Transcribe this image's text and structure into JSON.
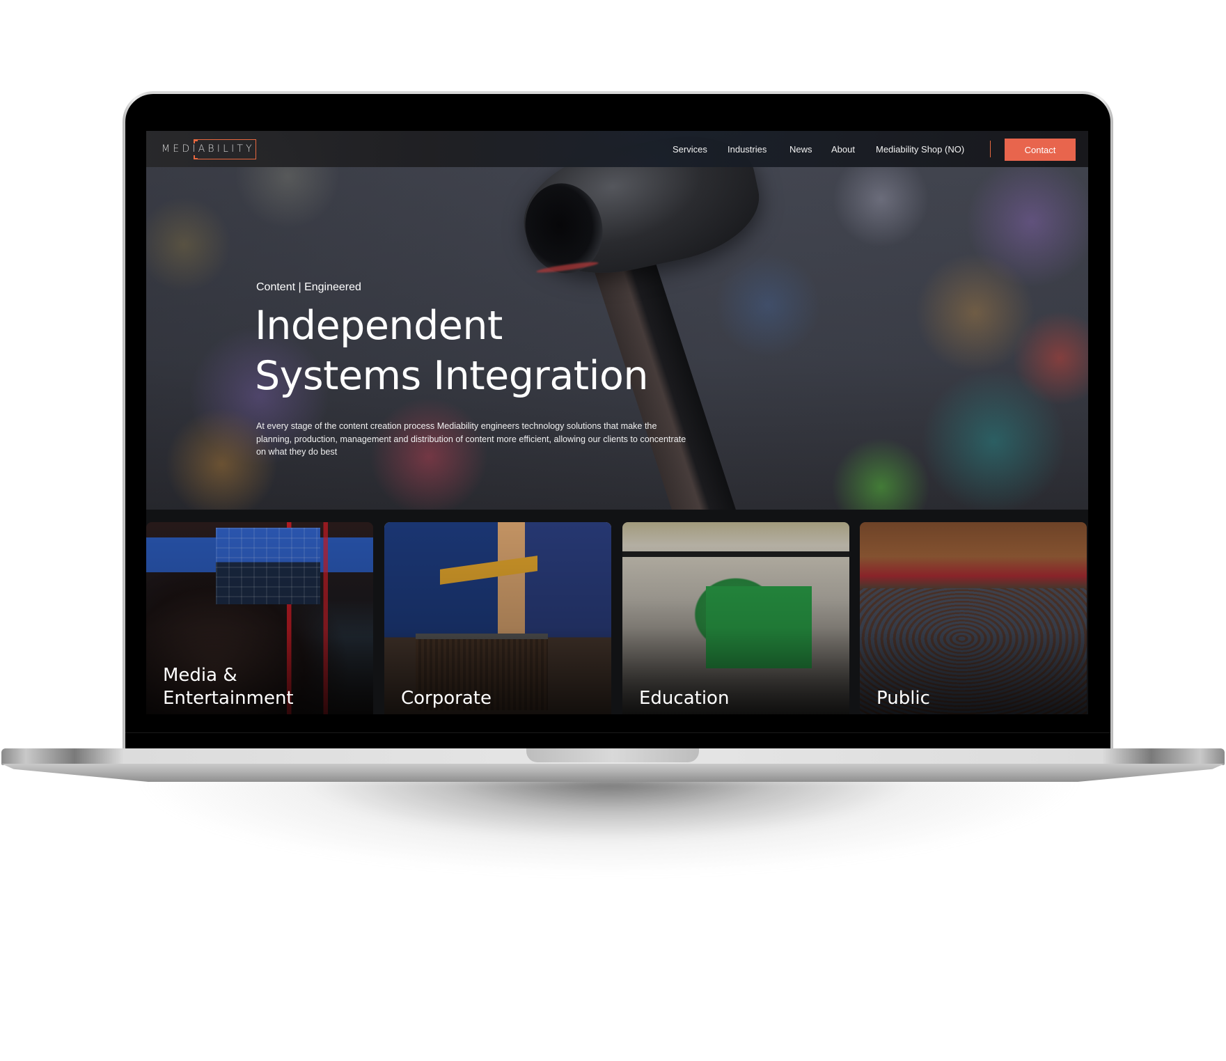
{
  "site": {
    "logo": "MEDIABILITY",
    "accent_color": "#e8654d"
  },
  "nav": {
    "items": [
      {
        "label": "Services"
      },
      {
        "label": "Industries"
      },
      {
        "label": "News"
      },
      {
        "label": "About"
      },
      {
        "label": "Mediability Shop (NO)"
      }
    ],
    "contact_label": "Contact"
  },
  "hero": {
    "eyebrow": "Content | Engineered",
    "headline_line1": "Independent",
    "headline_line2": "Systems Integration",
    "description": "At every stage of the content creation process Mediability engineers technology solutions that make the planning, production, management and distribution of content more efficient, allowing our clients to concentrate on what they do best"
  },
  "industries": [
    {
      "label": "Media & Entertainment"
    },
    {
      "label": "Corporate"
    },
    {
      "label": "Education"
    },
    {
      "label": "Public"
    }
  ]
}
